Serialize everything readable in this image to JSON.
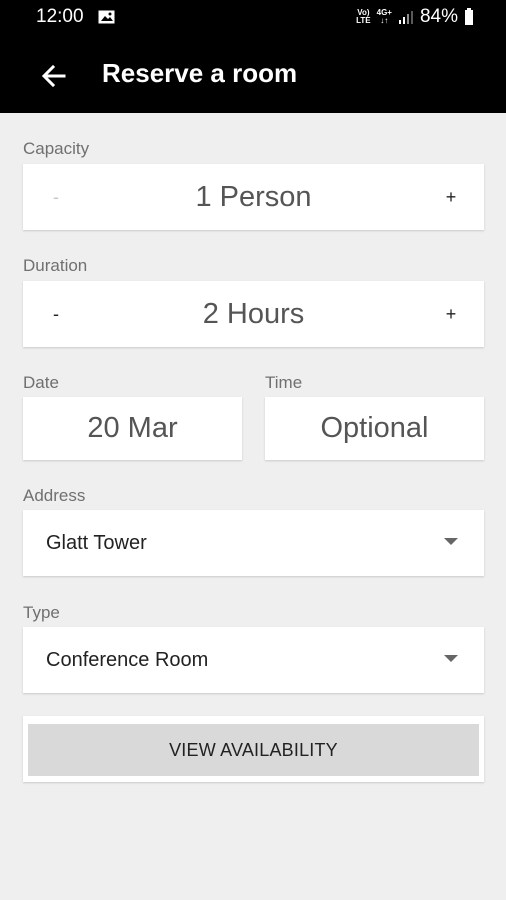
{
  "status_bar": {
    "time": "12:00",
    "image_icon": "image-icon",
    "volte": [
      "Vo)",
      "LTE"
    ],
    "network_4g": [
      "4G+",
      "↓↑"
    ],
    "battery_percent": "84%",
    "battery_level": 0.84,
    "signal_icon": "signal-icon",
    "battery_icon": "battery-icon"
  },
  "appbar": {
    "back_icon": "back-arrow-icon",
    "title": "Reserve a room"
  },
  "capacity": {
    "label": "Capacity",
    "minus_label": "-",
    "value": "1 Person",
    "plus_label": "+"
  },
  "duration": {
    "label": "Duration",
    "minus_label": "-",
    "value": "2 Hours",
    "plus_label": "+"
  },
  "date": {
    "label": "Date",
    "value": "20 Mar"
  },
  "time": {
    "label": "Time",
    "value": "Optional"
  },
  "address": {
    "label": "Address",
    "value": "Glatt Tower",
    "caret_icon": "dropdown-caret-icon"
  },
  "type": {
    "label": "Type",
    "value": "Conference Room",
    "caret_icon": "dropdown-caret-icon"
  },
  "actions": {
    "view_availability": "VIEW AVAILABILITY"
  },
  "colors": {
    "topbar": "#000000",
    "background": "#efefef",
    "button": "#d9d9d9",
    "label": "#707070"
  }
}
